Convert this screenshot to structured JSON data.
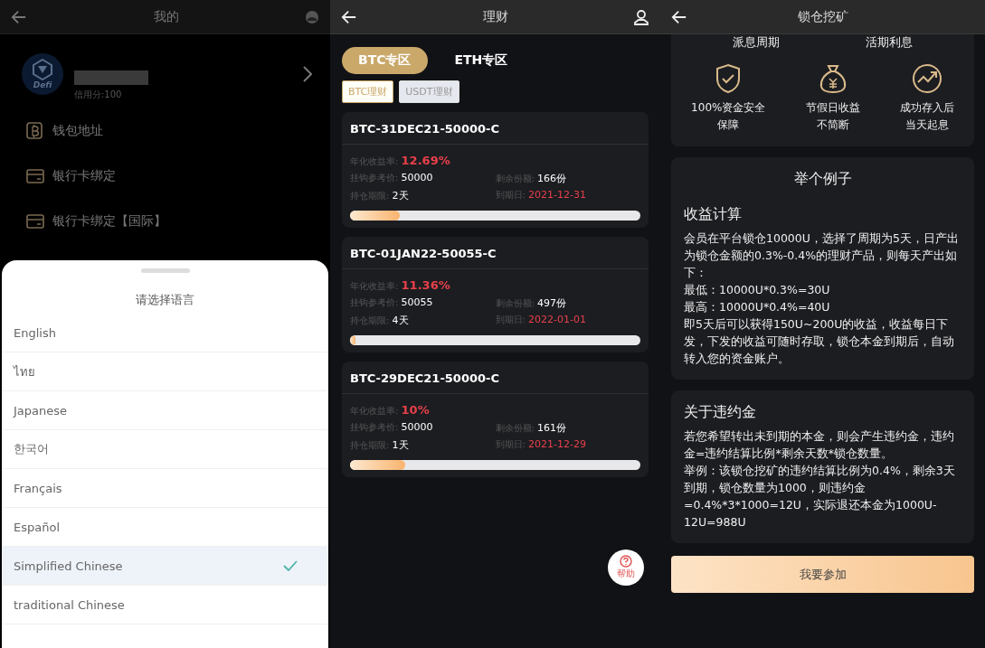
{
  "profile_screen": {
    "title": "我的",
    "logo_text": "Defi",
    "credit": "信用分:100",
    "menu": [
      {
        "label": "钱包地址",
        "kind": "wallet"
      },
      {
        "label": "银行卡绑定",
        "kind": "card"
      },
      {
        "label": "银行卡绑定【国际】",
        "kind": "card"
      }
    ],
    "language_sheet": {
      "title": "请选择语言",
      "options": [
        {
          "label": "English",
          "selected": false
        },
        {
          "label": "ไทย",
          "selected": false
        },
        {
          "label": "Japanese",
          "selected": false
        },
        {
          "label": "한국어",
          "selected": false
        },
        {
          "label": "Français",
          "selected": false
        },
        {
          "label": "Español",
          "selected": false
        },
        {
          "label": "Simplified Chinese",
          "selected": true
        },
        {
          "label": "traditional Chinese",
          "selected": false
        }
      ]
    }
  },
  "finance_screen": {
    "title": "理财",
    "zones": [
      {
        "label": "BTC专区",
        "selected": true
      },
      {
        "label": "ETH专区",
        "selected": false
      }
    ],
    "sub_tabs": [
      {
        "label": "BTC理财",
        "selected": true
      },
      {
        "label": "USDT理财",
        "selected": false
      }
    ],
    "products": [
      {
        "name": "BTC-31DEC21-50000-C",
        "rate_label": "年化收益率:",
        "rate": "12.69%",
        "price_label": "挂钩参考价:",
        "price": "50000",
        "remaining_label": "剩余份额:",
        "remaining": "166份",
        "term_label": "持仓期限:",
        "term": "2天",
        "expiry_label": "到期日:",
        "expiry": "2021-12-31",
        "level": 0.17
      },
      {
        "name": "BTC-01JAN22-50055-C",
        "rate_label": "年化收益率:",
        "rate": "11.36%",
        "price_label": "挂钩参考价:",
        "price": "50055",
        "remaining_label": "剩余份额:",
        "remaining": "497份",
        "term_label": "持仓期限:",
        "term": "4天",
        "expiry_label": "到期日:",
        "expiry": "2022-01-01",
        "level": 0.02
      },
      {
        "name": "BTC-29DEC21-50000-C",
        "rate_label": "年化收益率:",
        "rate": "10%",
        "price_label": "挂钩参考价:",
        "price": "50000",
        "remaining_label": "剩余份额:",
        "remaining": "161份",
        "term_label": "持仓期限:",
        "term": "1天",
        "expiry_label": "到期日:",
        "expiry": "2021-12-29",
        "level": 0.19
      }
    ],
    "help_label": "帮助"
  },
  "mining_screen": {
    "title": "锁仓挖矿",
    "top_labels": [
      "派息周期",
      "活期利息"
    ],
    "features": [
      {
        "kind": "shield",
        "lines": [
          "100%资金安全",
          "保障"
        ]
      },
      {
        "kind": "moneybag",
        "lines": [
          "节假日收益",
          "不简断"
        ]
      },
      {
        "kind": "trend",
        "lines": [
          "成功存入后",
          "当天起息"
        ]
      }
    ],
    "example_card": {
      "title": "举个例子",
      "heading": "收益计算",
      "lines": [
        "会员在平台锁仓10000U，选择了周期为5天，日产出为锁仓金额的0.3%-0.4%的理财产品，则每天产出如下：",
        "最低：10000U*0.3%=30U",
        "最高：10000U*0.4%=40U",
        "即5天后可以获得150U~200U的收益，收益每日下发，下发的收益可随时存取，锁仓本金到期后，自动转入您的资金账户。"
      ]
    },
    "penalty_card": {
      "heading": "关于违约金",
      "lines": [
        "若您希望转出未到期的本金，则会产生违约金，违约金=违约结算比例*剩余天数*锁仓数量。",
        "举例：该锁仓挖矿的违约结算比例为0.4%，剩余3天到期，锁仓数量为1000，则违约金=0.4%*3*1000=12U，实际退还本金为1000U-12U=988U"
      ]
    },
    "join_button": "我要参加"
  }
}
